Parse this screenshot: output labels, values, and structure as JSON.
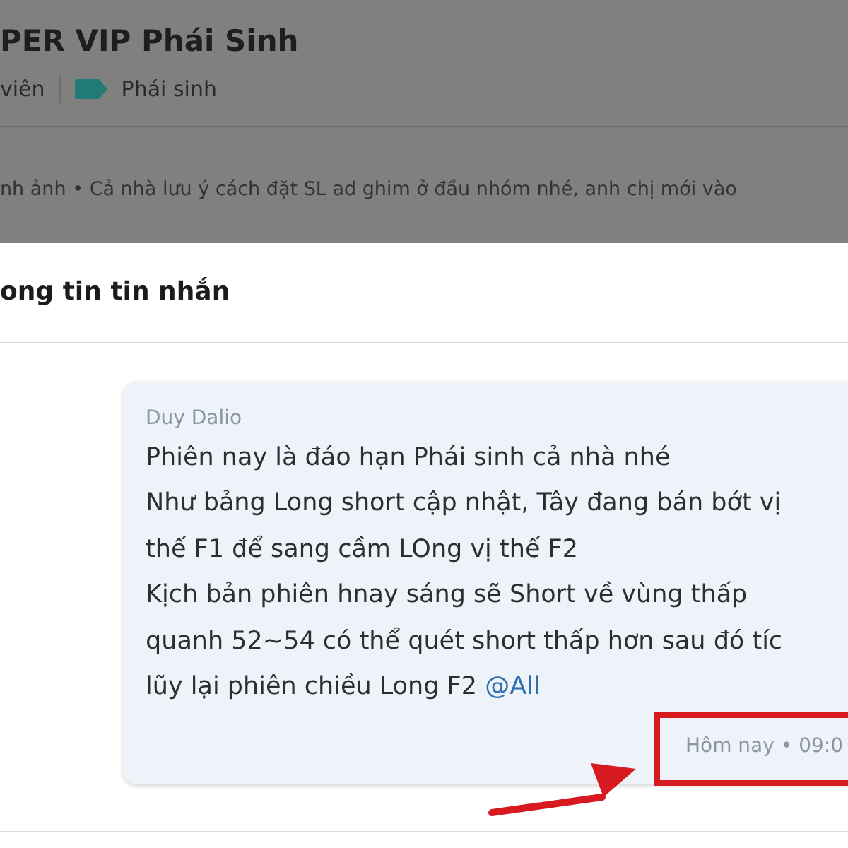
{
  "background": {
    "title": "PER VIP Phái Sinh",
    "members": "viên",
    "tag": {
      "label": "Phái sinh",
      "color": "#1f7b73"
    },
    "pinned": "nh ảnh • Cả nhà lưu ý cách đặt SL ad ghim ở đầu nhóm nhé, anh chị mới vào"
  },
  "dialog": {
    "title": "ong tin tin nhắn",
    "message": {
      "author": "Duy Dalio",
      "lines": [
        "Phiên nay là đáo hạn Phái sinh cả nhà nhé",
        "Như bảng Long short cập nhật, Tây đang bán bớt vị",
        "thế F1 để sang cầm LOng vị thế F2",
        "Kịch bản phiên hnay sáng sẽ Short về vùng thấp",
        "quanh 52~54 có thể quét short thấp hơn sau đó tíc",
        "lũy lại phiên chiều Long F2"
      ],
      "mention": "@All",
      "time": "Hôm nay • 09:0"
    }
  }
}
